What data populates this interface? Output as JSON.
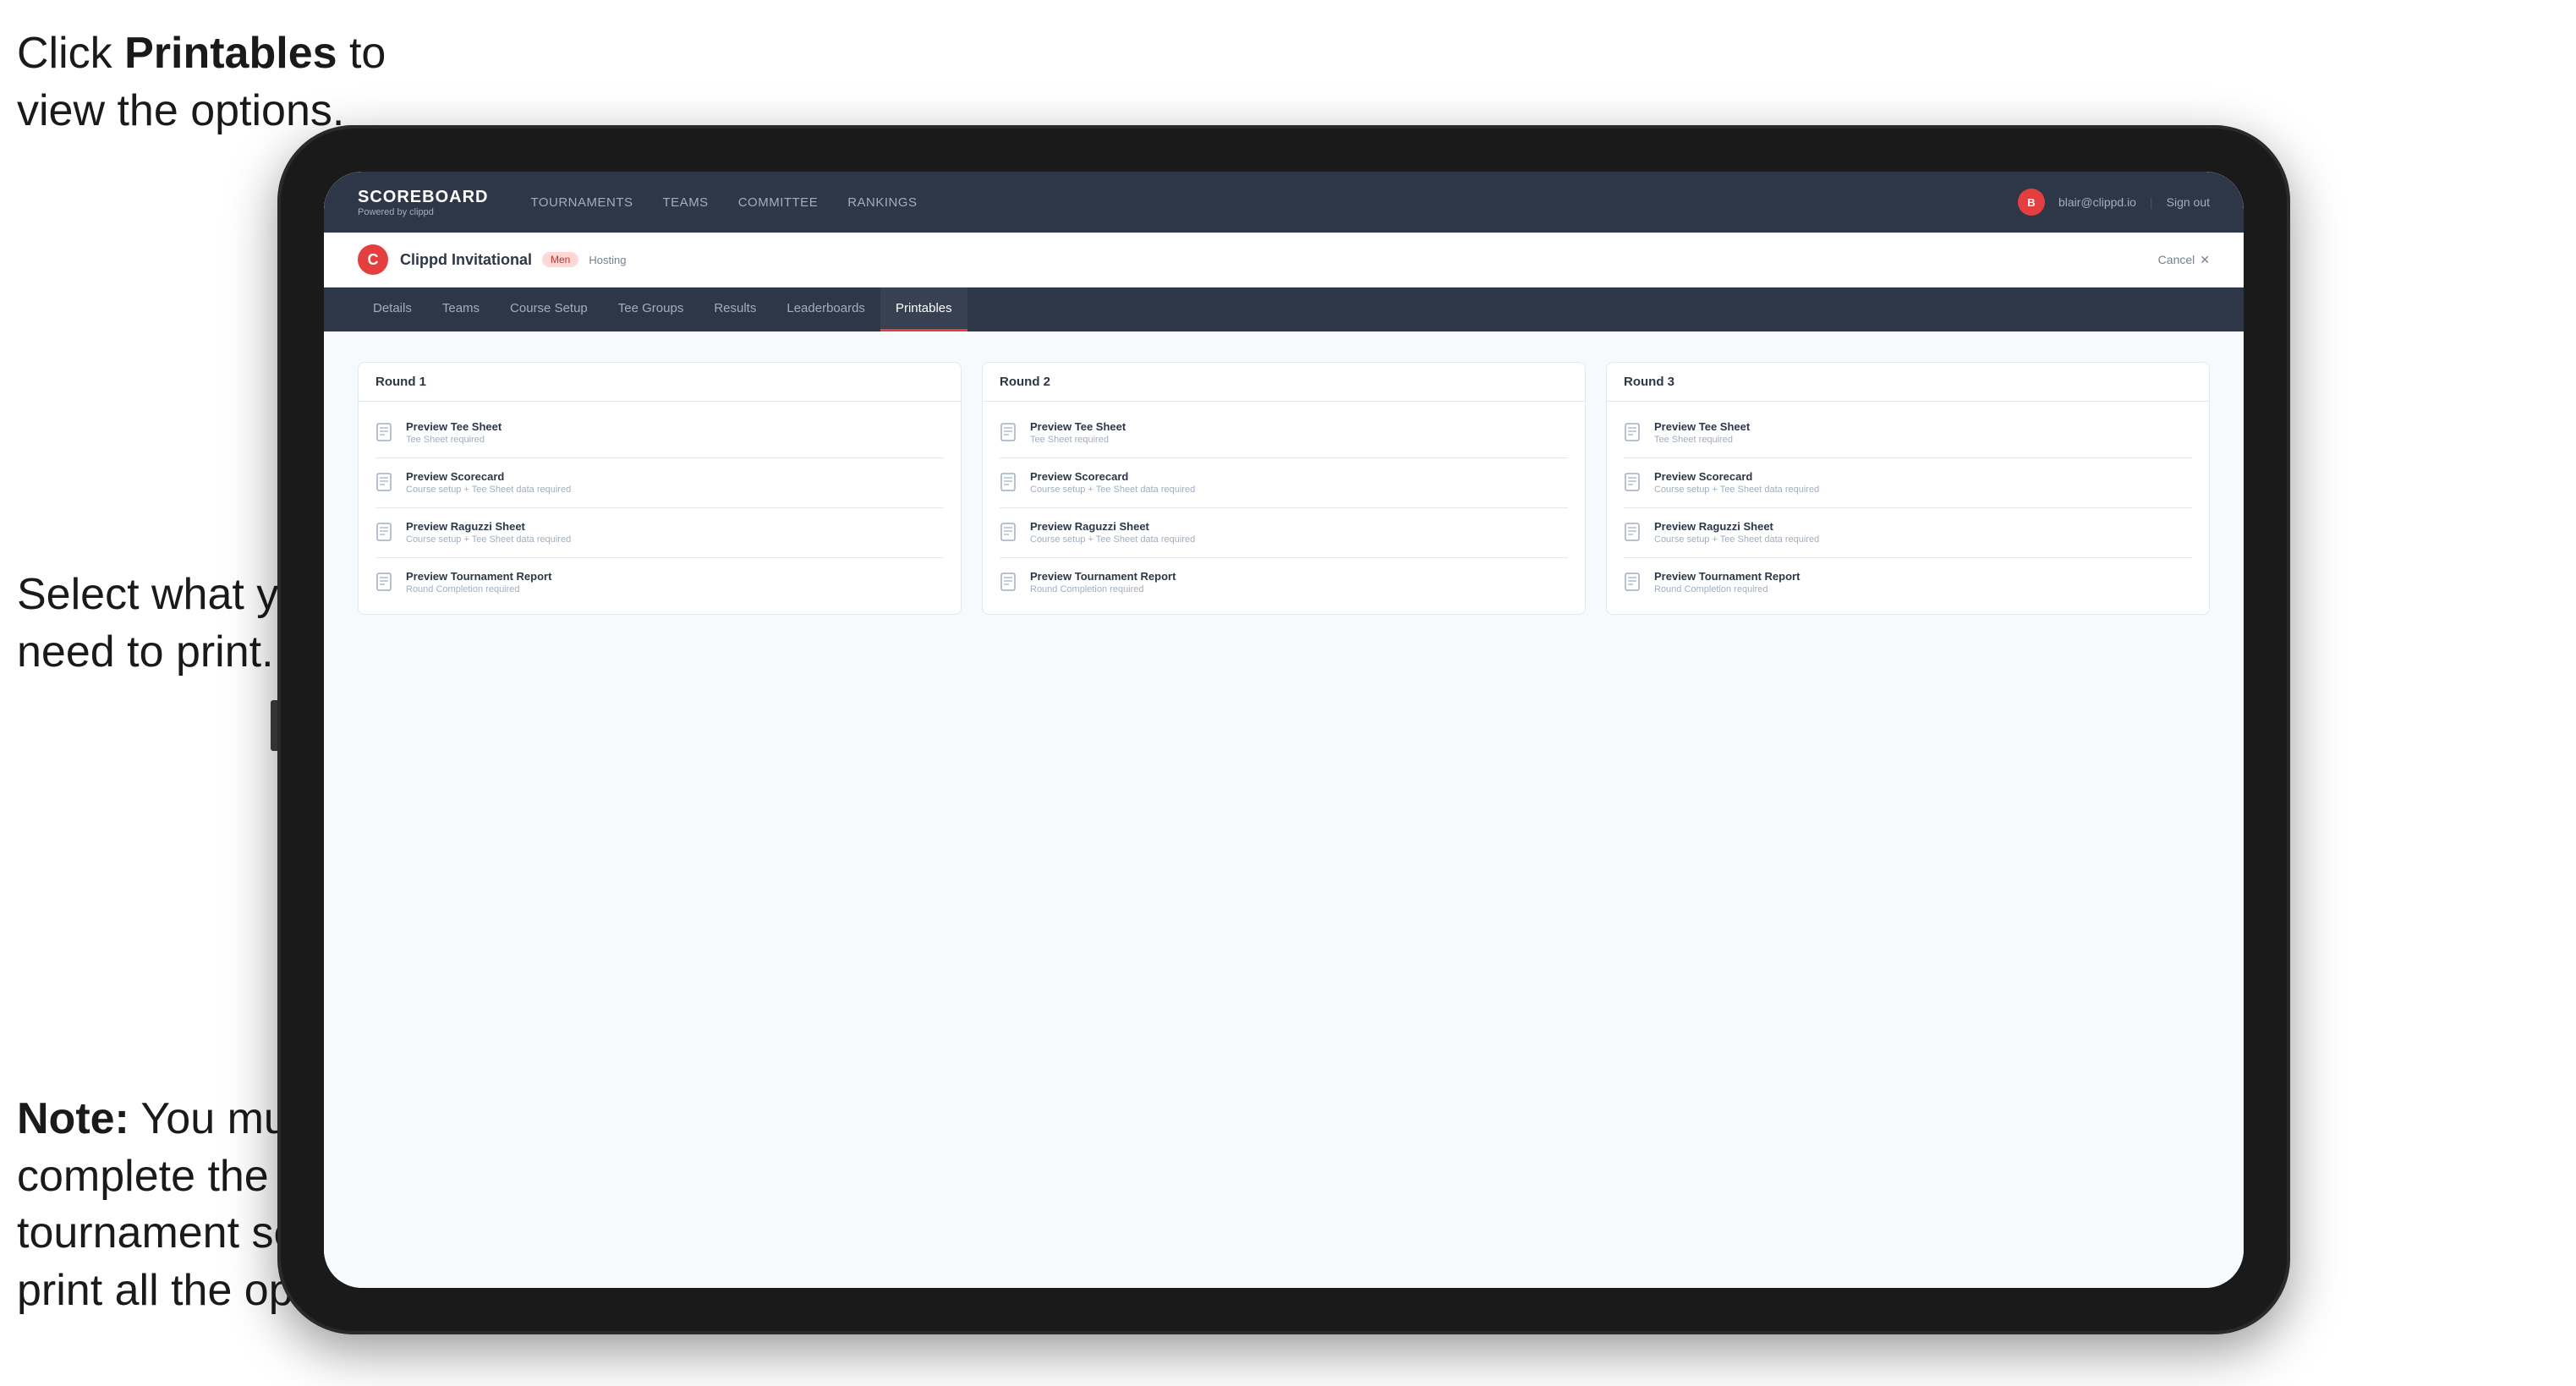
{
  "annotations": {
    "top": {
      "line1": "Click ",
      "bold": "Printables",
      "line2": " to",
      "line3": "view the options."
    },
    "middle": {
      "line1": "Select what you",
      "line2": "need to print."
    },
    "bottom": {
      "bold": "Note:",
      "text": " You must complete the tournament set-up to print all the options."
    }
  },
  "nav": {
    "brand": "SCOREBOARD",
    "brand_sub": "Powered by clippd",
    "links": [
      "TOURNAMENTS",
      "TEAMS",
      "COMMITTEE",
      "RANKINGS"
    ],
    "user_email": "blair@clippd.io",
    "sign_out": "Sign out",
    "separator": "|"
  },
  "tournament": {
    "name": "Clippd Invitational",
    "badge": "Men",
    "hosting": "Hosting",
    "cancel": "Cancel",
    "logo_letter": "C"
  },
  "tabs": [
    {
      "label": "Details",
      "active": false
    },
    {
      "label": "Teams",
      "active": false
    },
    {
      "label": "Course Setup",
      "active": false
    },
    {
      "label": "Tee Groups",
      "active": false
    },
    {
      "label": "Results",
      "active": false
    },
    {
      "label": "Leaderboards",
      "active": false
    },
    {
      "label": "Printables",
      "active": true
    }
  ],
  "rounds": [
    {
      "header": "Round 1",
      "items": [
        {
          "label": "Preview Tee Sheet",
          "sublabel": "Tee Sheet required"
        },
        {
          "label": "Preview Scorecard",
          "sublabel": "Course setup + Tee Sheet data required"
        },
        {
          "label": "Preview Raguzzi Sheet",
          "sublabel": "Course setup + Tee Sheet data required"
        },
        {
          "label": "Preview Tournament Report",
          "sublabel": "Round Completion required"
        }
      ]
    },
    {
      "header": "Round 2",
      "items": [
        {
          "label": "Preview Tee Sheet",
          "sublabel": "Tee Sheet required"
        },
        {
          "label": "Preview Scorecard",
          "sublabel": "Course setup + Tee Sheet data required"
        },
        {
          "label": "Preview Raguzzi Sheet",
          "sublabel": "Course setup + Tee Sheet data required"
        },
        {
          "label": "Preview Tournament Report",
          "sublabel": "Round Completion required"
        }
      ]
    },
    {
      "header": "Round 3",
      "items": [
        {
          "label": "Preview Tee Sheet",
          "sublabel": "Tee Sheet required"
        },
        {
          "label": "Preview Scorecard",
          "sublabel": "Course setup + Tee Sheet data required"
        },
        {
          "label": "Preview Raguzzi Sheet",
          "sublabel": "Course setup + Tee Sheet data required"
        },
        {
          "label": "Preview Tournament Report",
          "sublabel": "Round Completion required"
        }
      ]
    }
  ]
}
